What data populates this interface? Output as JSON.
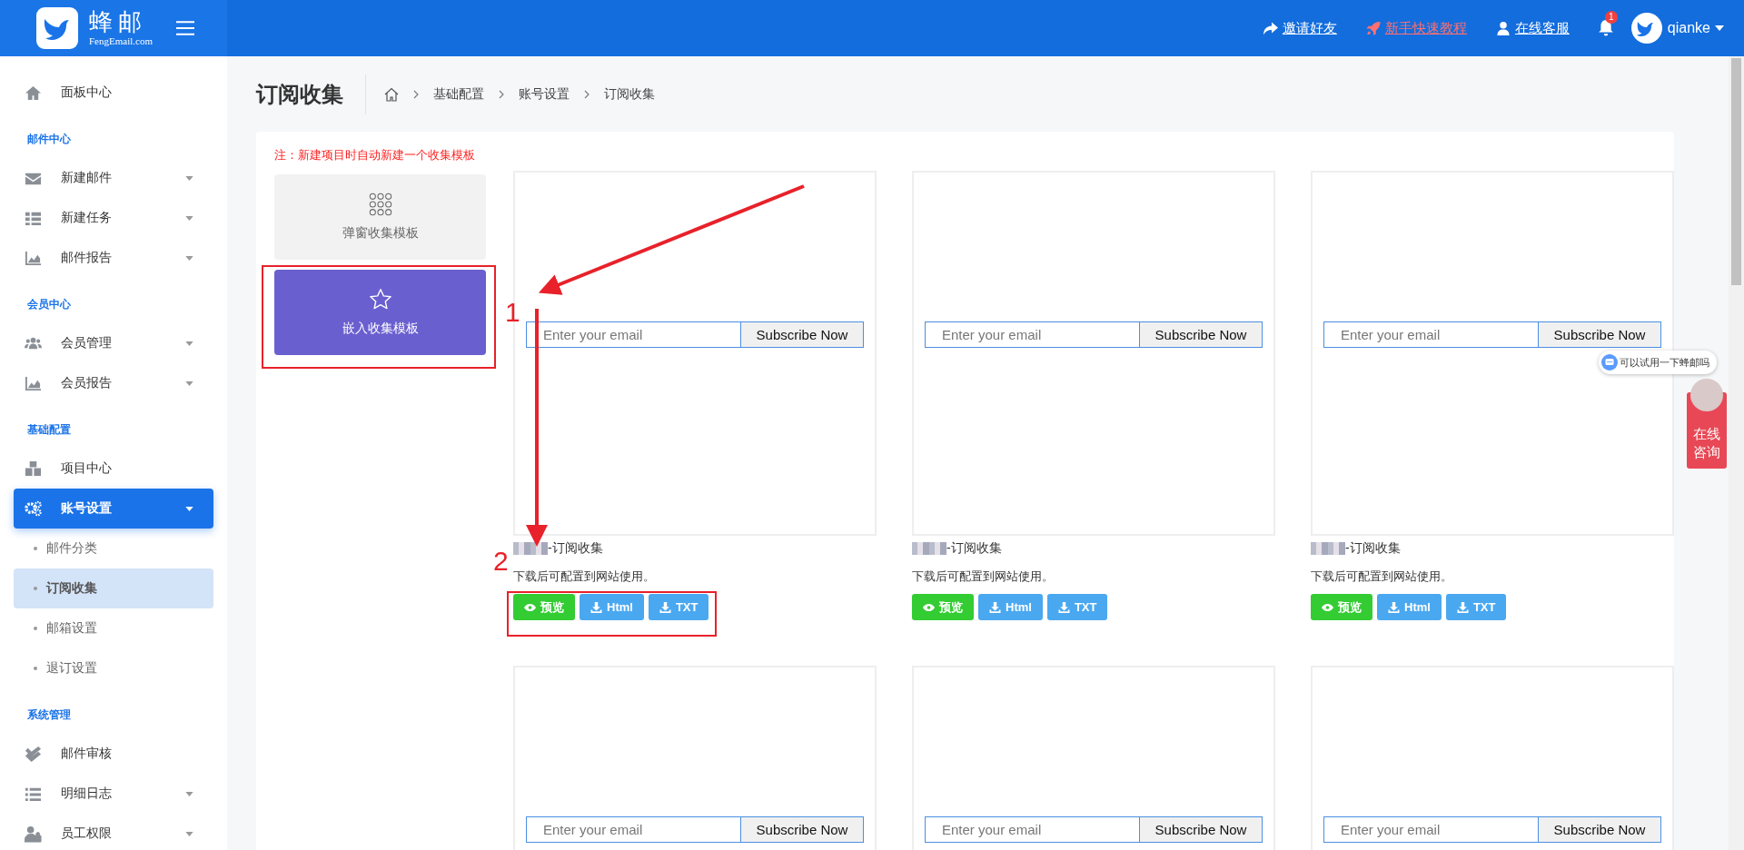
{
  "header": {
    "logo_title": "蜂邮",
    "logo_subtitle": "FengEmail.com",
    "links": [
      {
        "kind": "share",
        "label": "邀请好友"
      },
      {
        "kind": "rocket",
        "label": "新手快速教程"
      },
      {
        "kind": "user",
        "label": "在线客服"
      }
    ],
    "notification_count": "1",
    "username": "qianke"
  },
  "sidebar": {
    "items": [
      {
        "kind": "item",
        "label": "面板中心",
        "expandable": false,
        "selected": false
      },
      {
        "kind": "section",
        "label": "邮件中心"
      },
      {
        "kind": "item",
        "label": "新建邮件",
        "expandable": true,
        "expanded": false,
        "selected": false
      },
      {
        "kind": "item",
        "label": "新建任务",
        "expandable": true,
        "expanded": false,
        "selected": false
      },
      {
        "kind": "item",
        "label": "邮件报告",
        "expandable": true,
        "expanded": false,
        "selected": false
      },
      {
        "kind": "section",
        "label": "会员中心"
      },
      {
        "kind": "item",
        "label": "会员管理",
        "expandable": true,
        "expanded": false,
        "selected": false
      },
      {
        "kind": "item",
        "label": "会员报告",
        "expandable": true,
        "expanded": false,
        "selected": false
      },
      {
        "kind": "section",
        "label": "基础配置"
      },
      {
        "kind": "item",
        "label": "项目中心",
        "expandable": false,
        "selected": false
      },
      {
        "kind": "item",
        "label": "账号设置",
        "expandable": true,
        "expanded": true,
        "selected": true,
        "children": [
          {
            "label": "邮件分类",
            "selected": false
          },
          {
            "label": "订阅收集",
            "selected": true
          },
          {
            "label": "邮箱设置",
            "selected": false
          },
          {
            "label": "退订设置",
            "selected": false
          }
        ]
      },
      {
        "kind": "section",
        "label": "系统管理"
      },
      {
        "kind": "item",
        "label": "邮件审核",
        "expandable": false,
        "selected": false
      },
      {
        "kind": "item",
        "label": "明细日志",
        "expandable": true,
        "expanded": false,
        "selected": false
      },
      {
        "kind": "item",
        "label": "员工权限",
        "expandable": true,
        "expanded": false,
        "selected": false
      }
    ]
  },
  "page_title": "订阅收集",
  "breadcrumb": [
    "基础配置",
    "账号设置",
    "订阅收集"
  ],
  "note": "注：新建项目时自动新建一个收集模板",
  "template_types": [
    {
      "label": "弹窗收集模板",
      "selected": false
    },
    {
      "label": "嵌入收集模板",
      "selected": true
    }
  ],
  "templates": [
    {
      "email_placeholder": "Enter your email",
      "button": "Subscribe Now",
      "title": "-订阅收集",
      "description": "下载后可配置到网站使用。",
      "actions": [
        {
          "kind": "preview",
          "label": "预览"
        },
        {
          "kind": "download",
          "label": "Html"
        },
        {
          "kind": "download",
          "label": "TXT"
        }
      ]
    },
    {
      "email_placeholder": "Enter your email",
      "button": "Subscribe Now",
      "title": "-订阅收集",
      "description": "下载后可配置到网站使用。",
      "actions": [
        {
          "kind": "preview",
          "label": "预览"
        },
        {
          "kind": "download",
          "label": "Html"
        },
        {
          "kind": "download",
          "label": "TXT"
        }
      ]
    },
    {
      "email_placeholder": "Enter your email",
      "button": "Subscribe Now",
      "title": "-订阅收集",
      "description": "下载后可配置到网站使用。",
      "actions": [
        {
          "kind": "preview",
          "label": "预览"
        },
        {
          "kind": "download",
          "label": "Html"
        },
        {
          "kind": "download",
          "label": "TXT"
        }
      ]
    },
    {
      "email_placeholder": "Enter your email",
      "button": "Subscribe Now"
    },
    {
      "email_placeholder": "Enter your email",
      "button": "Subscribe Now"
    },
    {
      "email_placeholder": "Enter your email",
      "button": "Subscribe Now"
    }
  ],
  "annotations": [
    {
      "label": "1"
    },
    {
      "label": "2"
    }
  ],
  "chat_bubble": "可以试用一下蜂邮吗",
  "consult_button": "在线咨询"
}
